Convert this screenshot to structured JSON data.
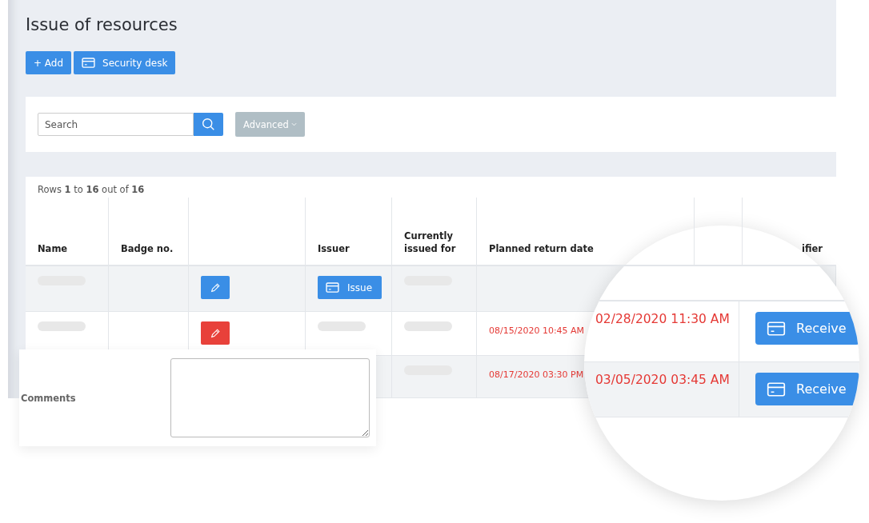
{
  "page": {
    "title": "Issue of resources"
  },
  "toolbar": [
    {
      "kind": "add",
      "label": "+ Add"
    },
    {
      "kind": "card",
      "label": "Security desk"
    }
  ],
  "filter": {
    "search": {
      "placeholder": "Search"
    },
    "advanced": {
      "label": "Advanced"
    }
  },
  "table": {
    "summary": "Rows **1** to **16** out of **16**",
    "columns": [
      "Name",
      "Badge no.",
      null,
      "Issuer",
      "Currently issued for",
      "Planned return date",
      null,
      "ifier"
    ],
    "rows": [
      {
        "cells": [
          {
            "kind": "redacted"
          },
          {
            "kind": "empty"
          },
          {
            "kind": "edit",
            "color": "#3a8ee6"
          },
          {
            "kind": "issue",
            "label": "Issue"
          },
          {
            "kind": "redacted"
          },
          {
            "kind": "empty"
          },
          null,
          {
            "kind": "empty"
          }
        ]
      },
      {
        "cells": [
          {
            "kind": "redacted"
          },
          {
            "kind": "empty"
          },
          {
            "kind": "edit",
            "color": "#e8413a"
          },
          {
            "kind": "redacted"
          },
          {
            "kind": "redacted"
          },
          {
            "kind": "date",
            "text": "08/15/2020 10:45 AM"
          }
        ]
      },
      {
        "cells": [
          null,
          {
            "kind": "empty"
          },
          {
            "kind": "empty"
          },
          {
            "kind": "empty"
          },
          {
            "kind": "redacted"
          },
          {
            "kind": "date",
            "text": "08/17/2020 03:30 PM"
          },
          {
            "kind": "empty"
          },
          {
            "kind": "empty"
          }
        ]
      }
    ]
  },
  "comments": {
    "label": "Comments"
  },
  "magnifier": {
    "rows": [
      {
        "date": "02/28/2020 11:30 AM",
        "button": "Receive"
      },
      {
        "date": "03/05/2020 03:45 AM",
        "button": "Receive"
      }
    ]
  }
}
